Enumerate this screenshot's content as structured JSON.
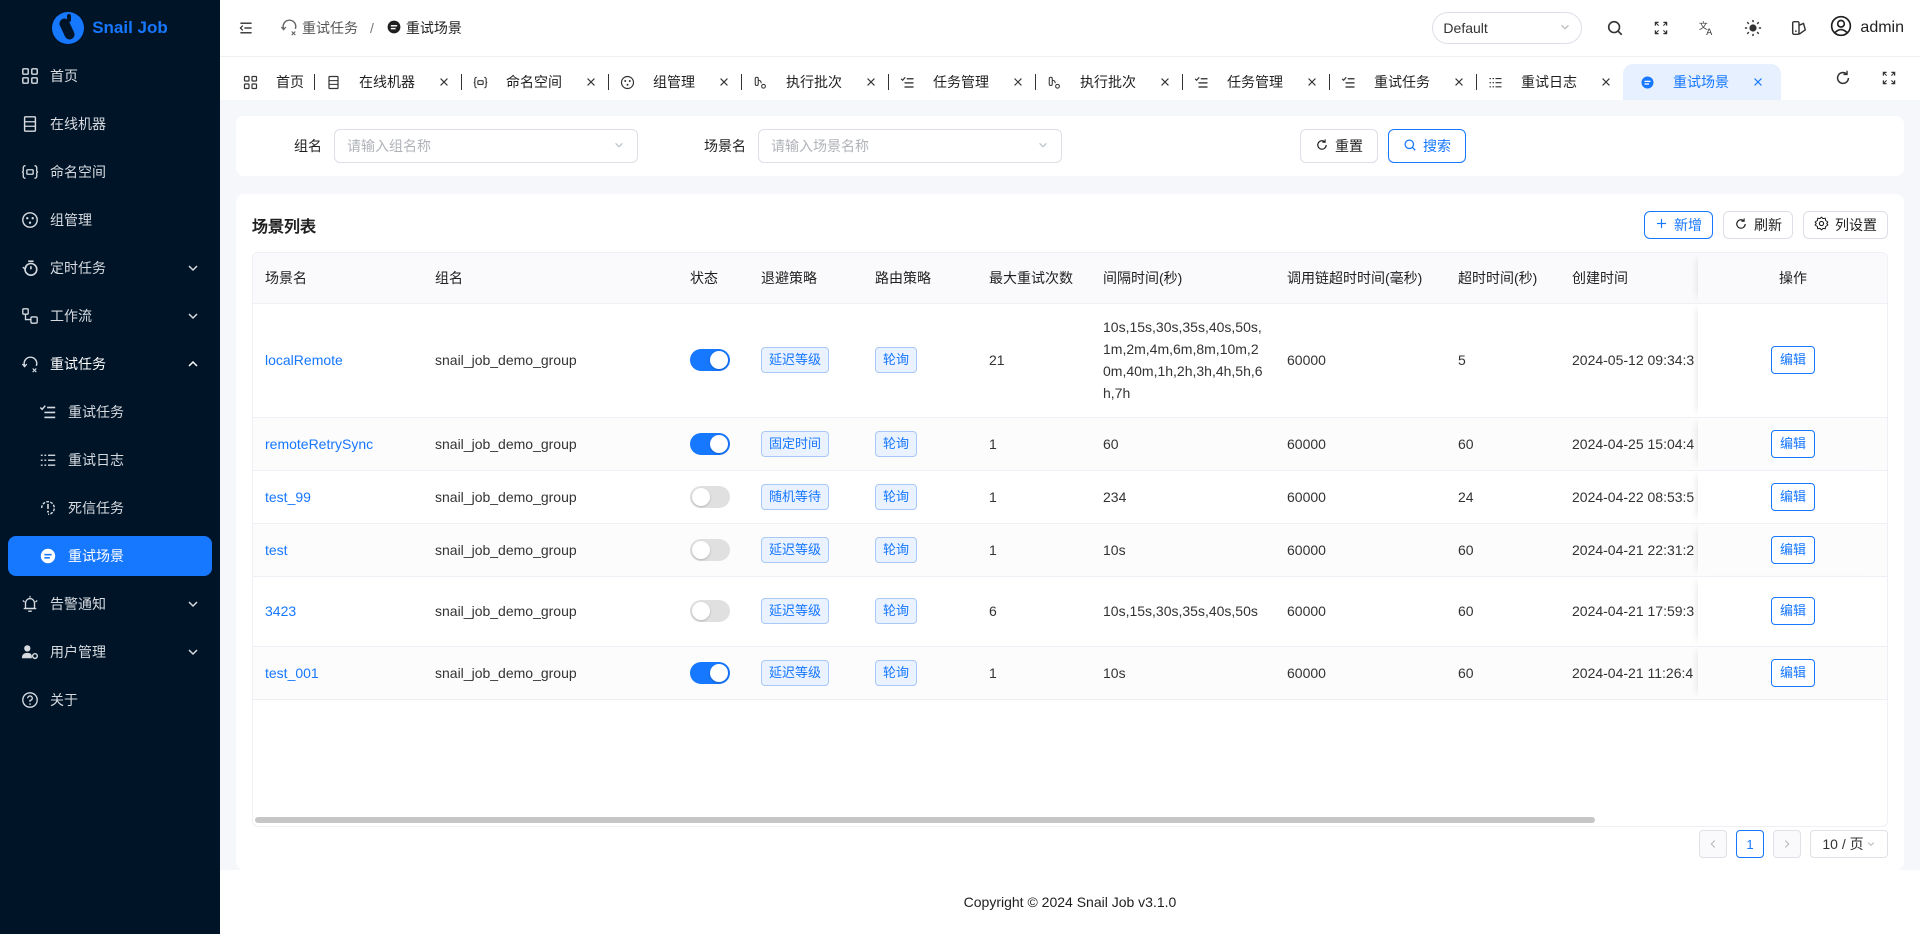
{
  "app": {
    "name": "Snail Job",
    "brand_color": "#1677ff"
  },
  "sidebar": {
    "items": [
      {
        "label": "首页",
        "icon": "dashboard-icon"
      },
      {
        "label": "在线机器",
        "icon": "server-icon"
      },
      {
        "label": "命名空间",
        "icon": "namespace-icon"
      },
      {
        "label": "组管理",
        "icon": "group-icon"
      },
      {
        "label": "定时任务",
        "icon": "timer-icon",
        "expandable": true
      },
      {
        "label": "工作流",
        "icon": "workflow-icon",
        "expandable": true
      },
      {
        "label": "重试任务",
        "icon": "retry-icon",
        "expandable": true,
        "expanded": true,
        "children": [
          {
            "label": "重试任务",
            "icon": "checklist-icon"
          },
          {
            "label": "重试日志",
            "icon": "list-icon"
          },
          {
            "label": "死信任务",
            "icon": "dead-letter-icon"
          },
          {
            "label": "重试场景",
            "icon": "scene-icon",
            "active": true
          }
        ]
      },
      {
        "label": "告警通知",
        "icon": "alarm-icon",
        "expandable": true
      },
      {
        "label": "用户管理",
        "icon": "user-manage-icon",
        "expandable": true
      },
      {
        "label": "关于",
        "icon": "help-icon"
      }
    ]
  },
  "header": {
    "breadcrumb": [
      {
        "label": "重试任务",
        "icon": "retry-icon"
      },
      {
        "label": "重试场景",
        "icon": "scene-icon"
      }
    ],
    "separator": "/",
    "namespace_select": "Default",
    "user": "admin"
  },
  "tabs": [
    {
      "label": "首页",
      "icon": "dashboard-icon",
      "closable": false
    },
    {
      "label": "在线机器",
      "icon": "server-icon",
      "closable": true
    },
    {
      "label": "命名空间",
      "icon": "namespace-icon",
      "closable": true
    },
    {
      "label": "组管理",
      "icon": "group-icon",
      "closable": true
    },
    {
      "label": "执行批次",
      "icon": "batch-icon",
      "closable": true
    },
    {
      "label": "任务管理",
      "icon": "checklist-icon",
      "closable": true
    },
    {
      "label": "执行批次",
      "icon": "batch-icon",
      "closable": true
    },
    {
      "label": "任务管理",
      "icon": "checklist-icon",
      "closable": true
    },
    {
      "label": "重试任务",
      "icon": "checklist-icon",
      "closable": true
    },
    {
      "label": "重试日志",
      "icon": "list-icon",
      "closable": true
    },
    {
      "label": "重试场景",
      "icon": "scene-icon",
      "closable": true,
      "active": true
    }
  ],
  "search": {
    "group_label": "组名",
    "group_placeholder": "请输入组名称",
    "scene_label": "场景名",
    "scene_placeholder": "请输入场景名称",
    "reset_label": "重置",
    "search_label": "搜索"
  },
  "table": {
    "title": "场景列表",
    "add_label": "新增",
    "refresh_label": "刷新",
    "columns_label": "列设置",
    "columns": [
      "场景名",
      "组名",
      "状态",
      "退避策略",
      "路由策略",
      "最大重试次数",
      "间隔时间(秒)",
      "调用链超时时间(毫秒)",
      "超时时间(秒)",
      "创建时间",
      "操作"
    ],
    "edit_label": "编辑",
    "rows": [
      {
        "scene": "localRemote",
        "group": "snail_job_demo_group",
        "enabled": true,
        "backoff": "延迟等级",
        "route": "轮询",
        "max_retry": "21",
        "interval": "10s,15s,30s,35s,40s,50s,1m,2m,4m,6m,8m,10m,20m,40m,1h,2h,3h,4h,5h,6h,7h",
        "trace_timeout": "60000",
        "timeout": "5",
        "created": "2024-05-12 09:34:3"
      },
      {
        "scene": "remoteRetrySync",
        "group": "snail_job_demo_group",
        "enabled": true,
        "backoff": "固定时间",
        "route": "轮询",
        "max_retry": "1",
        "interval": "60",
        "trace_timeout": "60000",
        "timeout": "60",
        "created": "2024-04-25 15:04:4"
      },
      {
        "scene": "test_99",
        "group": "snail_job_demo_group",
        "enabled": false,
        "backoff": "随机等待",
        "route": "轮询",
        "max_retry": "1",
        "interval": "234",
        "trace_timeout": "60000",
        "timeout": "24",
        "created": "2024-04-22 08:53:5"
      },
      {
        "scene": "test",
        "group": "snail_job_demo_group",
        "enabled": false,
        "backoff": "延迟等级",
        "route": "轮询",
        "max_retry": "1",
        "interval": "10s",
        "trace_timeout": "60000",
        "timeout": "60",
        "created": "2024-04-21 22:31:2"
      },
      {
        "scene": "3423",
        "group": "snail_job_demo_group",
        "enabled": false,
        "backoff": "延迟等级",
        "route": "轮询",
        "max_retry": "6",
        "interval": "10s,15s,30s,35s,40s,50s",
        "trace_timeout": "60000",
        "timeout": "60",
        "created": "2024-04-21 17:59:3"
      },
      {
        "scene": "test_001",
        "group": "snail_job_demo_group",
        "enabled": true,
        "backoff": "延迟等级",
        "route": "轮询",
        "max_retry": "1",
        "interval": "10s",
        "trace_timeout": "60000",
        "timeout": "60",
        "created": "2024-04-21 11:26:4"
      }
    ]
  },
  "pagination": {
    "current": "1",
    "page_size": "10 / 页"
  },
  "footer": {
    "copyright": "Copyright © 2024 Snail Job v3.1.0"
  }
}
